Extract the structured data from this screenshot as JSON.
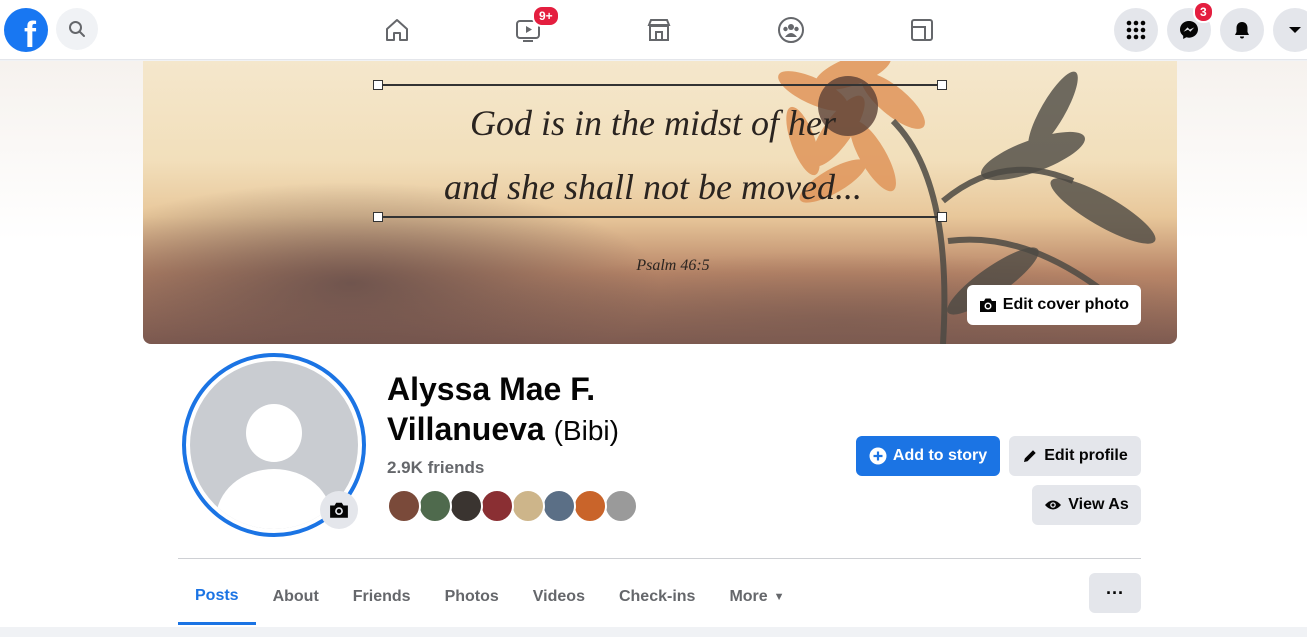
{
  "topbar": {
    "logo_letter": "f",
    "watch_badge": "9+",
    "messenger_badge": "3",
    "icons": [
      "facebook-logo",
      "search-icon",
      "home-icon",
      "watch-icon",
      "marketplace-icon",
      "groups-icon",
      "gaming-icon",
      "menu-grid-icon",
      "messenger-icon",
      "notifications-icon",
      "account-caret-icon"
    ]
  },
  "cover": {
    "quote_line1": "God is in the midst of her",
    "quote_line2": "and she shall not be moved...",
    "citation": "Psalm 46:5",
    "edit_label": "Edit cover photo"
  },
  "profile": {
    "name_line1": "Alyssa Mae F.",
    "name_line2": "Villanueva",
    "alternate_name": "(Bibi)",
    "friends_count": "2.9K friends",
    "friend_face_colors": [
      "#7a4a3a",
      "#4f6a4d",
      "#3a3430",
      "#8a2f33",
      "#cdb58a",
      "#5b6f86",
      "#c9642a",
      "#9a9a9a"
    ]
  },
  "actions": {
    "add_story": "Add to story",
    "edit_profile": "Edit profile",
    "view_as": "View As"
  },
  "tabs": [
    {
      "label": "Posts",
      "active": true
    },
    {
      "label": "About"
    },
    {
      "label": "Friends"
    },
    {
      "label": "Photos"
    },
    {
      "label": "Videos"
    },
    {
      "label": "Check-ins"
    },
    {
      "label": "More",
      "has_caret": true
    }
  ],
  "colors": {
    "accent": "#1b74e4",
    "badge": "#e41e3f",
    "secondary_text": "#65676b"
  }
}
